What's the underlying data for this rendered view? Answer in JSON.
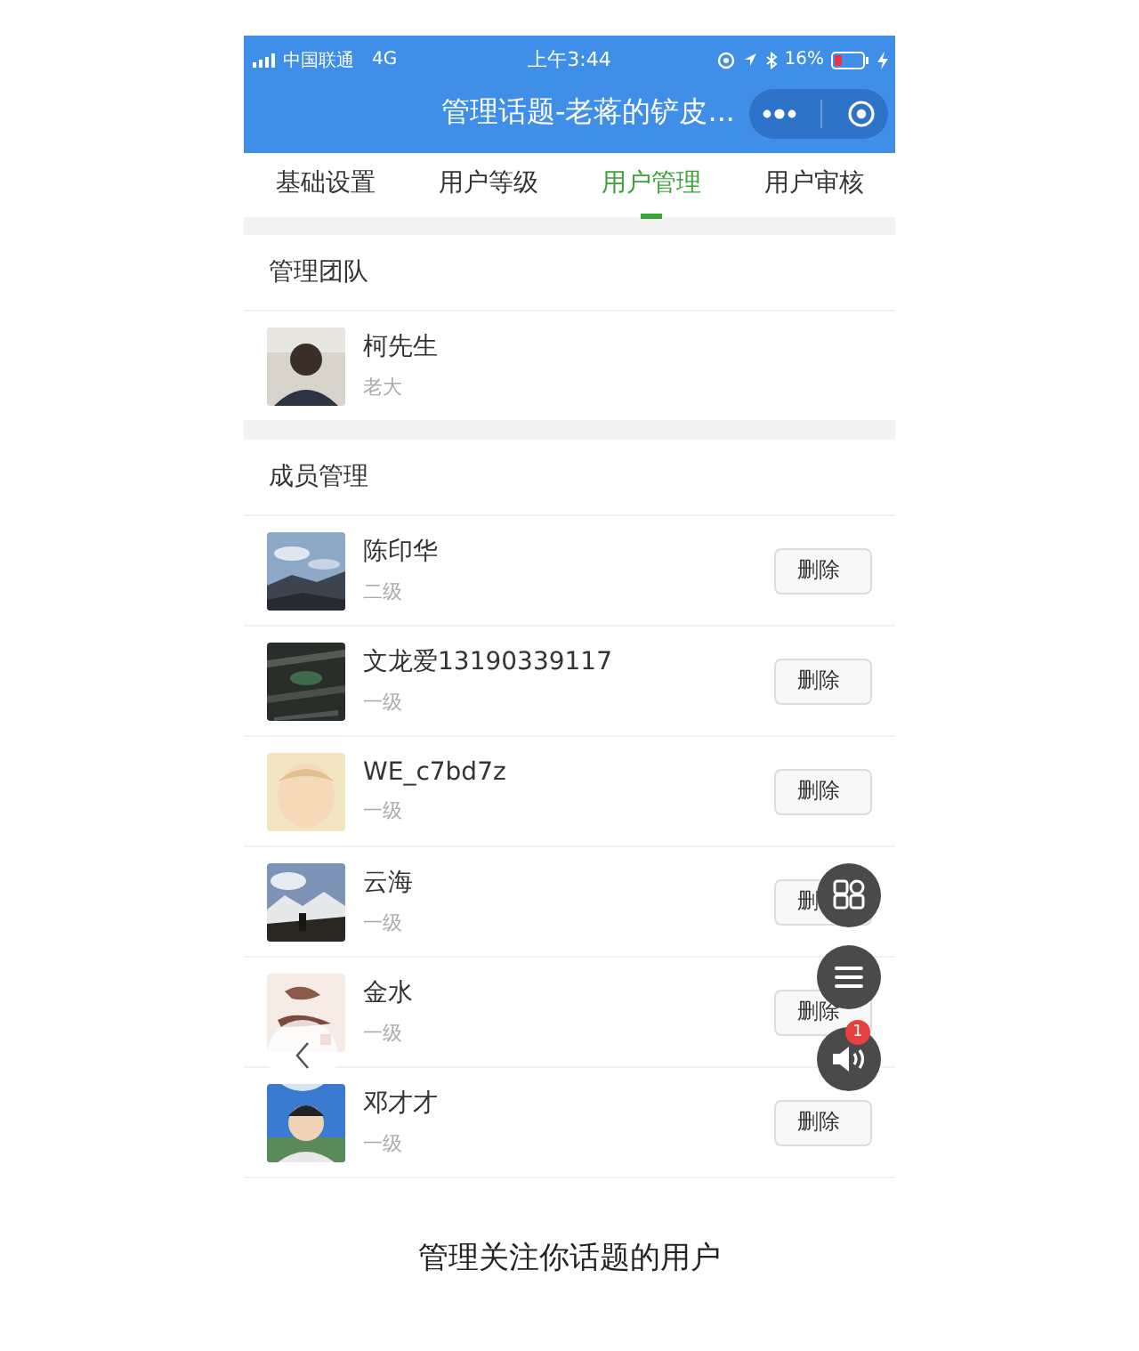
{
  "status_bar": {
    "carrier": "中国联通",
    "network": "4G",
    "time": "上午3:44",
    "battery": "16%"
  },
  "nav": {
    "title": "管理话题-老蒋的铲皮..."
  },
  "tabs": [
    {
      "label": "基础设置",
      "selected": false
    },
    {
      "label": "用户等级",
      "selected": false
    },
    {
      "label": "用户管理",
      "selected": true
    },
    {
      "label": "用户审核",
      "selected": false
    }
  ],
  "sections": [
    {
      "title": "管理团队",
      "members": [
        {
          "name": "柯先生",
          "role": "老大"
        }
      ]
    },
    {
      "title": "成员管理",
      "members": [
        {
          "name": "陈印华",
          "role": "二级",
          "action": "删除"
        },
        {
          "name": "文龙爱13190339117",
          "role": "一级",
          "action": "删除"
        },
        {
          "name": "WE_c7bd7z",
          "role": "一级",
          "action": "删除"
        },
        {
          "name": "云海",
          "role": "一级",
          "action": "删"
        },
        {
          "name": "金水",
          "role": "一级",
          "action": "删除"
        },
        {
          "name": "邓才才",
          "role": "一级",
          "action": "删除"
        }
      ]
    }
  ],
  "floating": {
    "badge": "1"
  },
  "caption": "管理关注你话题的用户"
}
